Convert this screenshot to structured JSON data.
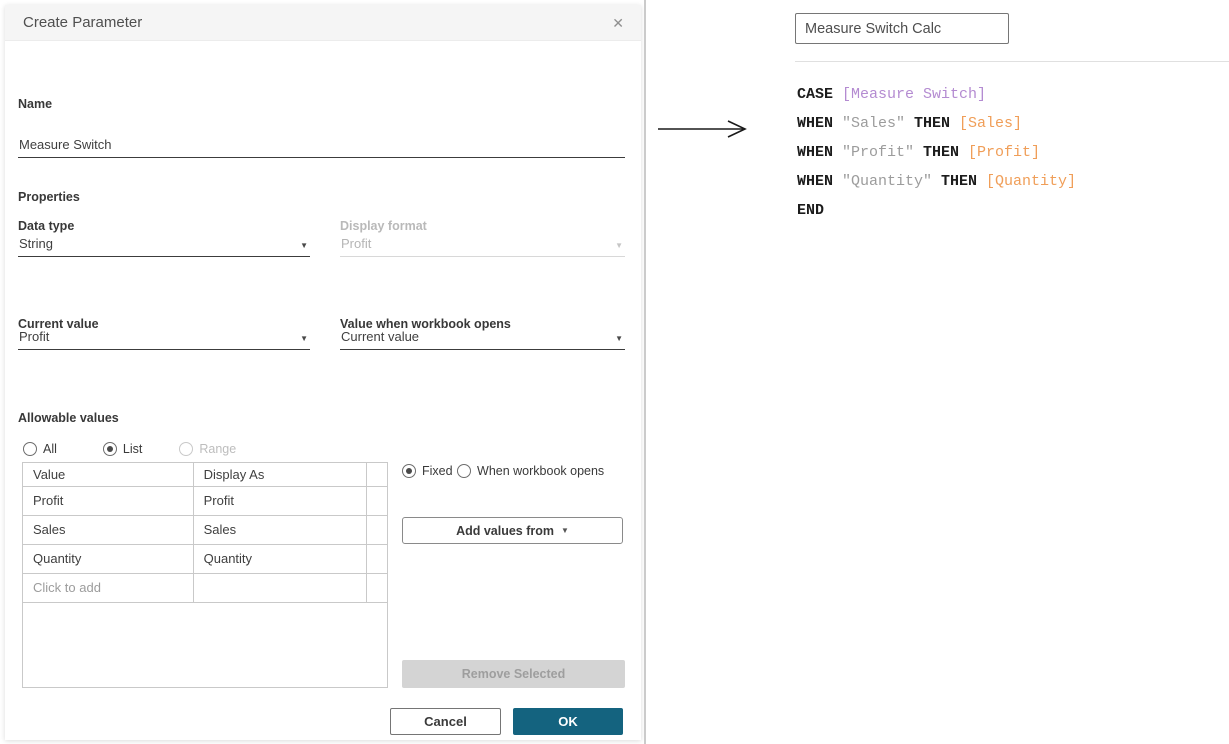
{
  "dialog": {
    "title": "Create Parameter",
    "name_field": {
      "label": "Name",
      "value": "Measure Switch"
    },
    "properties_heading": "Properties",
    "fields": {
      "data_type": {
        "label": "Data type",
        "value": "String"
      },
      "display_format": {
        "label": "Display format",
        "value": "Profit",
        "disabled": true
      },
      "current_value": {
        "label": "Current value",
        "value": "Profit"
      },
      "value_when_workbook_opens": {
        "label": "Value when workbook opens",
        "value": "Current value"
      }
    },
    "allowable_values": {
      "heading": "Allowable values",
      "options": [
        {
          "label": "All",
          "state": "unselected"
        },
        {
          "label": "List",
          "state": "selected"
        },
        {
          "label": "Range",
          "state": "disabled"
        }
      ]
    },
    "values_table": {
      "columns": [
        "Value",
        "Display As"
      ],
      "rows": [
        {
          "value": "Profit",
          "display_as": "Profit"
        },
        {
          "value": "Sales",
          "display_as": "Sales"
        },
        {
          "value": "Quantity",
          "display_as": "Quantity"
        }
      ],
      "placeholder": "Click to add"
    },
    "value_source": {
      "options": [
        {
          "label": "Fixed",
          "state": "selected"
        },
        {
          "label": "When workbook opens",
          "state": "unselected"
        }
      ],
      "add_values_button": "Add values from",
      "remove_selected_button": "Remove Selected"
    },
    "footer": {
      "cancel_button": "Cancel",
      "ok_button": "OK"
    }
  },
  "calc_editor": {
    "name": "Measure Switch Calc",
    "code_lines": [
      [
        {
          "type": "keyword",
          "text": "CASE "
        },
        {
          "type": "parameter",
          "text": "[Measure Switch]"
        }
      ],
      [
        {
          "type": "keyword",
          "text": "WHEN "
        },
        {
          "type": "string",
          "text": "\"Sales\""
        },
        {
          "type": "keyword",
          "text": " THEN "
        },
        {
          "type": "field",
          "text": "[Sales]"
        }
      ],
      [
        {
          "type": "keyword",
          "text": "WHEN "
        },
        {
          "type": "string",
          "text": "\"Profit\""
        },
        {
          "type": "keyword",
          "text": " THEN "
        },
        {
          "type": "field",
          "text": "[Profit]"
        }
      ],
      [
        {
          "type": "keyword",
          "text": "WHEN "
        },
        {
          "type": "string",
          "text": "\"Quantity\""
        },
        {
          "type": "keyword",
          "text": " THEN "
        },
        {
          "type": "field",
          "text": "[Quantity]"
        }
      ],
      [
        {
          "type": "keyword",
          "text": "END"
        }
      ]
    ]
  },
  "colors": {
    "ok_button": "#14637f",
    "titlebar_bg": "#f5f5f5",
    "divider": "#cbcbcb",
    "code_keyword": "#1c1c1c",
    "code_string": "#9c9c9c",
    "code_parameter": "#b48bd1",
    "code_field": "#f09e58"
  }
}
